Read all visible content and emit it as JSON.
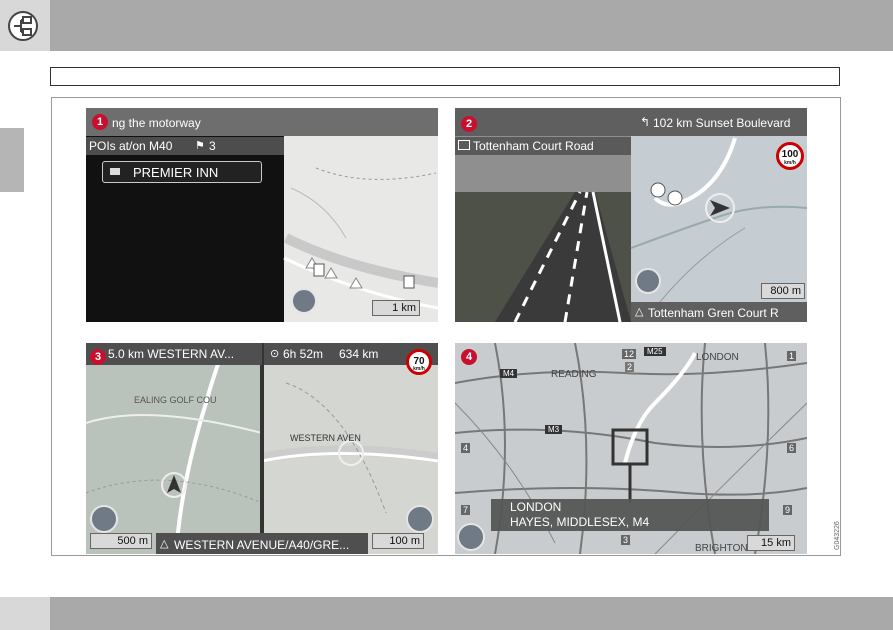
{
  "panel1": {
    "badge": "1",
    "title": "ng the motorway",
    "poi_header": "POIs at/on M40",
    "poi_count": "3",
    "poi_item": "PREMIER INN",
    "scale": "1 km"
  },
  "panel2": {
    "badge": "2",
    "distance_street": "102 km  Sunset Boulevard",
    "road": "Tottenham Court Road",
    "speed_value": "100",
    "speed_unit": "km/h",
    "scale": "800 m",
    "bottom_street": "Tottenham Gren Court R"
  },
  "panel3": {
    "badge": "3",
    "distance_street": "5.0 km  WESTERN AV...",
    "eta": "6h 52m",
    "total_distance": "634 km",
    "speed_value": "70",
    "speed_unit": "km/h",
    "map_label_1": "EALING GOLF COU",
    "map_label_2": "WESTERN AVEN",
    "scale_left": "500 m",
    "bottom_street": "WESTERN AVENUE/A40/GRE...",
    "scale_right": "100 m"
  },
  "panel4": {
    "badge": "4",
    "road_m25": "M25",
    "road_m4": "M4",
    "road_m3": "M3",
    "city_reading": "READING",
    "city_london": "LONDON",
    "city_brighton": "BRIGHTON",
    "info_line1": "LONDON",
    "info_line2": "HAYES, MIDDLESEX, M4",
    "num_12": "12",
    "num_1": "1",
    "num_2": "2",
    "num_4": "4",
    "num_6": "6",
    "num_7": "7",
    "num_9": "9",
    "num_3": "3",
    "scale": "15 km"
  },
  "figure_ref": "G043226",
  "colors": {
    "bar_gray": "#a9a9a9",
    "badge_red": "#c8102e",
    "speed_red": "#cc0000",
    "route_white": "#ffffff"
  }
}
